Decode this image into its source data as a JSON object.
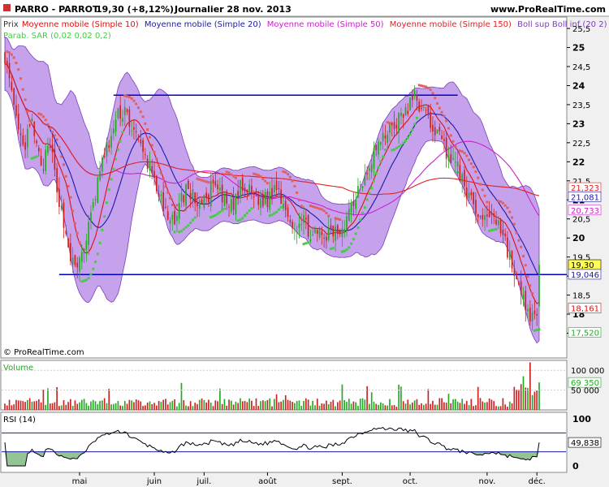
{
  "header": {
    "title": "PARRO - PARROT",
    "quote": "19,30 (+8,12%)",
    "period": "Journalier  28 nov. 2013",
    "site": "www.ProRealTime.com"
  },
  "copyright": "© ProRealTime.com",
  "legend": {
    "prix": "Prix",
    "ma10": "Moyenne mobile (Simple 10)",
    "ma20": "Moyenne mobile (Simple 20)",
    "ma50": "Moyenne mobile (Simple 50)",
    "ma150": "Moyenne mobile (Simple 150)",
    "boll": "Boll sup Boll inf (20 2)",
    "sar": "Parab. SAR (0,02 0,02 0,2)"
  },
  "colors": {
    "up": "#22aa22",
    "down": "#cc2222",
    "ma10": "#dd1111",
    "ma20": "#1a1aaa",
    "ma50": "#cc22cc",
    "ma150": "#dd2222",
    "boll_fill": "#b383e6",
    "boll_line": "#7a3fb8",
    "sar_up": "#44cc44",
    "sar_down": "#e06060",
    "hline": "#0000cc",
    "rsi": "#000000"
  },
  "chart_data": [
    {
      "type": "candlestick",
      "name": "price",
      "ylim": [
        16.85,
        25.8
      ],
      "yticks": [
        "25,5",
        "25",
        "24,5",
        "24",
        "23,5",
        "23",
        "22,5",
        "22",
        "21,5",
        "21",
        "20,5",
        "20",
        "19,5",
        "19",
        "18,5",
        "18",
        "17,5"
      ],
      "x_labels": [
        "mai",
        "juin",
        "juil.",
        "août",
        "sept.",
        "oct.",
        "nov.",
        "déc."
      ],
      "horizontal_lines": [
        23.75,
        19.04
      ],
      "value_labels": [
        {
          "text": "21,323",
          "value": 21.323,
          "color": "#dd2222",
          "bg": "#ffffff"
        },
        {
          "text": "21,081",
          "value": 21.081,
          "color": "#1a1aaa",
          "bg": "#ffffff"
        },
        {
          "text": "20,733",
          "value": 20.733,
          "color": "#cc22cc",
          "bg": "#ffffff"
        },
        {
          "text": "19,30",
          "value": 19.3,
          "color": "#000000",
          "bg": "#ffff55"
        },
        {
          "text": "19,046",
          "value": 19.046,
          "color": "#1a1aaa",
          "bg": "#ffffff"
        },
        {
          "text": "18,161",
          "value": 18.161,
          "color": "#dd1111",
          "bg": "#ffffff"
        },
        {
          "text": "17,520",
          "value": 17.52,
          "color": "#22aa22",
          "bg": "#ffffff"
        }
      ],
      "close_anchors": [
        [
          0,
          24.8
        ],
        [
          4,
          23.3
        ],
        [
          8,
          22.3
        ],
        [
          12,
          23.0
        ],
        [
          16,
          21.8
        ],
        [
          20,
          22.4
        ],
        [
          25,
          20.7
        ],
        [
          28,
          19.8
        ],
        [
          31,
          19.1
        ],
        [
          34,
          19.6
        ],
        [
          38,
          20.5
        ],
        [
          42,
          21.8
        ],
        [
          46,
          22.5
        ],
        [
          50,
          23.2
        ],
        [
          53,
          23.4
        ],
        [
          56,
          22.9
        ],
        [
          59,
          22.5
        ],
        [
          62,
          22.1
        ],
        [
          66,
          21.6
        ],
        [
          70,
          20.7
        ],
        [
          73,
          20.3
        ],
        [
          76,
          20.7
        ],
        [
          80,
          21.3
        ],
        [
          84,
          21.0
        ],
        [
          88,
          20.9
        ],
        [
          92,
          21.4
        ],
        [
          96,
          21.0
        ],
        [
          100,
          20.8
        ],
        [
          104,
          21.3
        ],
        [
          108,
          21.2
        ],
        [
          112,
          21.0
        ],
        [
          116,
          21.0
        ],
        [
          120,
          21.4
        ],
        [
          124,
          20.8
        ],
        [
          128,
          20.3
        ],
        [
          132,
          20.4
        ],
        [
          136,
          20.1
        ],
        [
          140,
          20.0
        ],
        [
          144,
          20.1
        ],
        [
          148,
          20.2
        ],
        [
          152,
          20.7
        ],
        [
          156,
          21.3
        ],
        [
          160,
          21.8
        ],
        [
          163,
          22.3
        ],
        [
          166,
          22.5
        ],
        [
          170,
          22.9
        ],
        [
          174,
          23.1
        ],
        [
          178,
          23.4
        ],
        [
          181,
          23.7
        ],
        [
          185,
          23.3
        ],
        [
          188,
          23.0
        ],
        [
          191,
          22.8
        ],
        [
          194,
          22.4
        ],
        [
          197,
          22.1
        ],
        [
          200,
          21.8
        ],
        [
          203,
          21.4
        ],
        [
          206,
          20.9
        ],
        [
          209,
          20.6
        ],
        [
          212,
          20.5
        ],
        [
          215,
          20.7
        ],
        [
          218,
          20.4
        ],
        [
          221,
          19.9
        ],
        [
          224,
          19.3
        ],
        [
          227,
          18.6
        ],
        [
          230,
          18.2
        ],
        [
          233,
          17.9
        ],
        [
          235,
          17.8
        ],
        [
          236,
          19.3
        ]
      ],
      "n_bars": 237,
      "ma": [
        {
          "key": "ma10",
          "period": 10
        },
        {
          "key": "ma20",
          "period": 20
        },
        {
          "key": "ma50",
          "period": 50
        },
        {
          "key": "ma150",
          "period": 150
        }
      ]
    },
    {
      "type": "bar",
      "name": "volume",
      "label": "Volume",
      "ylim": [
        0,
        125000
      ],
      "yticks": [
        "100 000",
        "50 000"
      ],
      "value_label": {
        "text": "69 350",
        "value": 69350
      }
    },
    {
      "type": "line",
      "name": "rsi",
      "label": "RSI (14)",
      "ylim": [
        0,
        100
      ],
      "yticks": [
        "100",
        "50",
        "0"
      ],
      "levels": [
        70,
        30
      ],
      "value_label": {
        "text": "49,838",
        "value": 49.838
      }
    }
  ]
}
